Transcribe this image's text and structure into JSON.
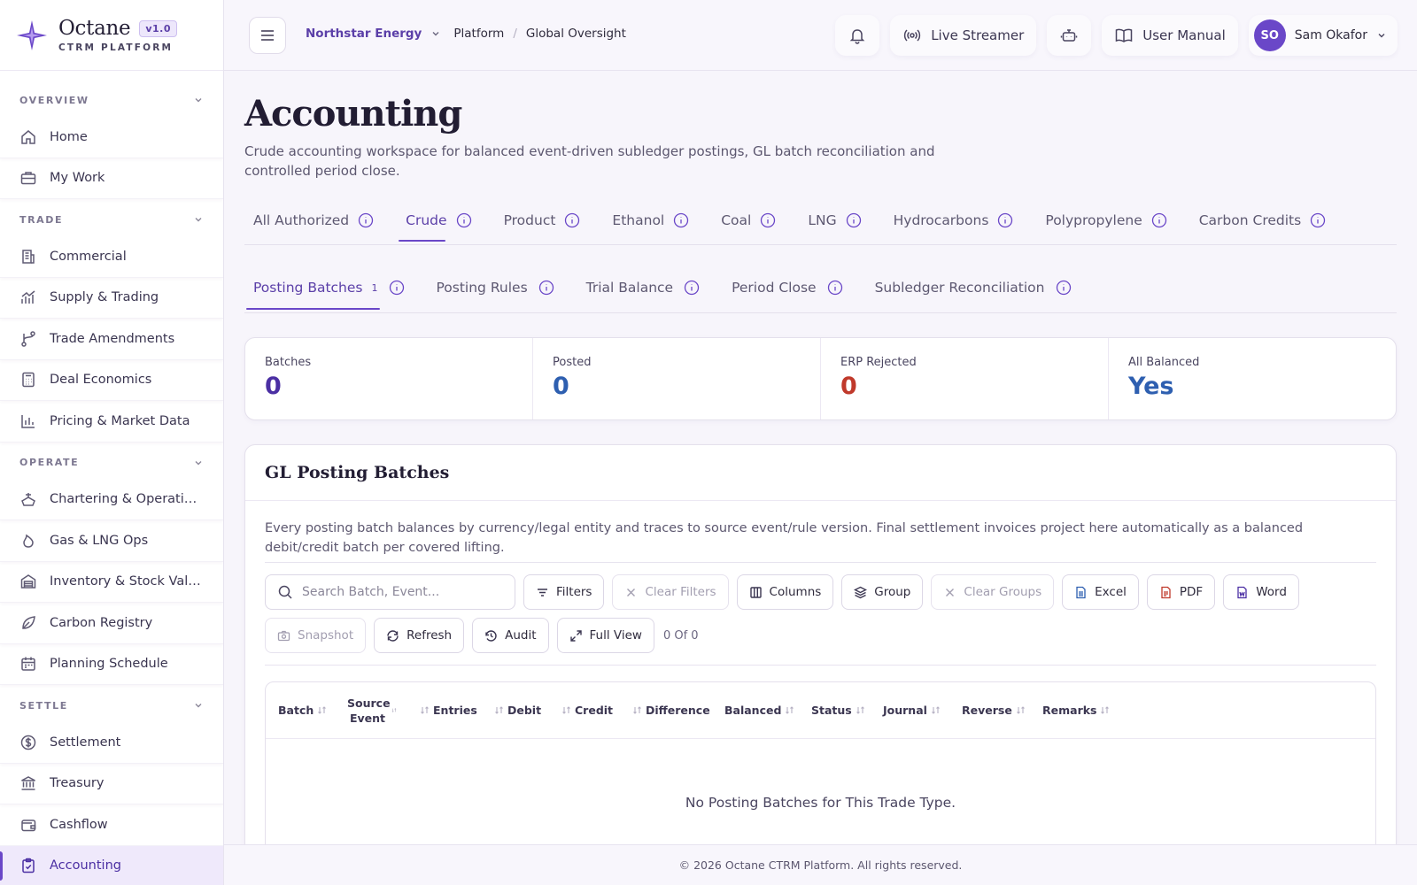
{
  "brand": {
    "name": "Octane",
    "version": "v1.0",
    "subtitle": "CTRM PLATFORM"
  },
  "sidebar": {
    "sections": [
      {
        "label": "OVERVIEW",
        "items": [
          {
            "label": "Home",
            "icon": "home-icon"
          },
          {
            "label": "My Work",
            "icon": "briefcase-icon"
          }
        ]
      },
      {
        "label": "TRADE",
        "items": [
          {
            "label": "Commercial",
            "icon": "building-icon"
          },
          {
            "label": "Supply & Trading",
            "icon": "trend-chart-icon"
          },
          {
            "label": "Trade Amendments",
            "icon": "git-branch-icon"
          },
          {
            "label": "Deal Economics",
            "icon": "calculator-icon"
          },
          {
            "label": "Pricing & Market Data",
            "icon": "bar-chart-icon"
          }
        ]
      },
      {
        "label": "OPERATE",
        "items": [
          {
            "label": "Chartering & Operations",
            "icon": "ship-icon"
          },
          {
            "label": "Gas & LNG Ops",
            "icon": "flame-icon"
          },
          {
            "label": "Inventory & Stock Valua...",
            "icon": "warehouse-icon"
          },
          {
            "label": "Carbon Registry",
            "icon": "leaf-icon"
          },
          {
            "label": "Planning Schedule",
            "icon": "calendar-icon"
          }
        ]
      },
      {
        "label": "SETTLE",
        "items": [
          {
            "label": "Settlement",
            "icon": "dollar-circle-icon"
          },
          {
            "label": "Treasury",
            "icon": "bank-icon"
          },
          {
            "label": "Cashflow",
            "icon": "wallet-icon"
          },
          {
            "label": "Accounting",
            "icon": "clipboard-check-icon",
            "active": true
          }
        ]
      }
    ]
  },
  "topbar": {
    "org": "Northstar Energy",
    "crumbs": [
      "Platform",
      "Global Oversight"
    ],
    "live_streamer": "Live Streamer",
    "user_manual": "User Manual",
    "user_initials": "SO",
    "user_name": "Sam Okafor"
  },
  "page": {
    "title": "Accounting",
    "description": "Crude accounting workspace for balanced event-driven subledger postings, GL batch reconciliation and controlled period close."
  },
  "tabs": [
    {
      "label": "All Authorized"
    },
    {
      "label": "Crude",
      "active": true
    },
    {
      "label": "Product"
    },
    {
      "label": "Ethanol"
    },
    {
      "label": "Coal"
    },
    {
      "label": "LNG"
    },
    {
      "label": "Hydrocarbons"
    },
    {
      "label": "Polypropylene"
    },
    {
      "label": "Carbon Credits"
    }
  ],
  "subtabs": [
    {
      "label": "Posting Batches",
      "count": "1",
      "active": true
    },
    {
      "label": "Posting Rules"
    },
    {
      "label": "Trial Balance"
    },
    {
      "label": "Period Close"
    },
    {
      "label": "Subledger Reconciliation"
    }
  ],
  "kpis": [
    {
      "label": "Batches",
      "value": "0",
      "color": "#4b2fa3"
    },
    {
      "label": "Posted",
      "value": "0",
      "color": "#2e5fb0"
    },
    {
      "label": "ERP Rejected",
      "value": "0",
      "color": "#c0392b"
    },
    {
      "label": "All Balanced",
      "value": "Yes",
      "color": "#2e5fb0"
    }
  ],
  "card": {
    "title": "GL Posting Batches",
    "description": "Every posting batch balances by currency/legal entity and traces to source event/rule version. Final settlement invoices project here automatically as a balanced debit/credit batch per covered lifting.",
    "search_placeholder": "Search Batch, Event...",
    "buttons": {
      "filters": "Filters",
      "clear_filters": "Clear Filters",
      "columns": "Columns",
      "group": "Group",
      "clear_groups": "Clear Groups",
      "excel": "Excel",
      "pdf": "PDF",
      "word": "Word",
      "snapshot": "Snapshot",
      "refresh": "Refresh",
      "audit": "Audit",
      "full_view": "Full View"
    },
    "row_count": "0 Of 0",
    "columns": [
      "Batch",
      "Source Event",
      "Entries",
      "Debit",
      "Credit",
      "Difference",
      "Balanced",
      "Status",
      "Journal",
      "Reverse",
      "Remarks"
    ],
    "empty_text": "No Posting Batches for This Trade Type."
  },
  "footer": "© 2026 Octane CTRM Platform. All rights reserved."
}
